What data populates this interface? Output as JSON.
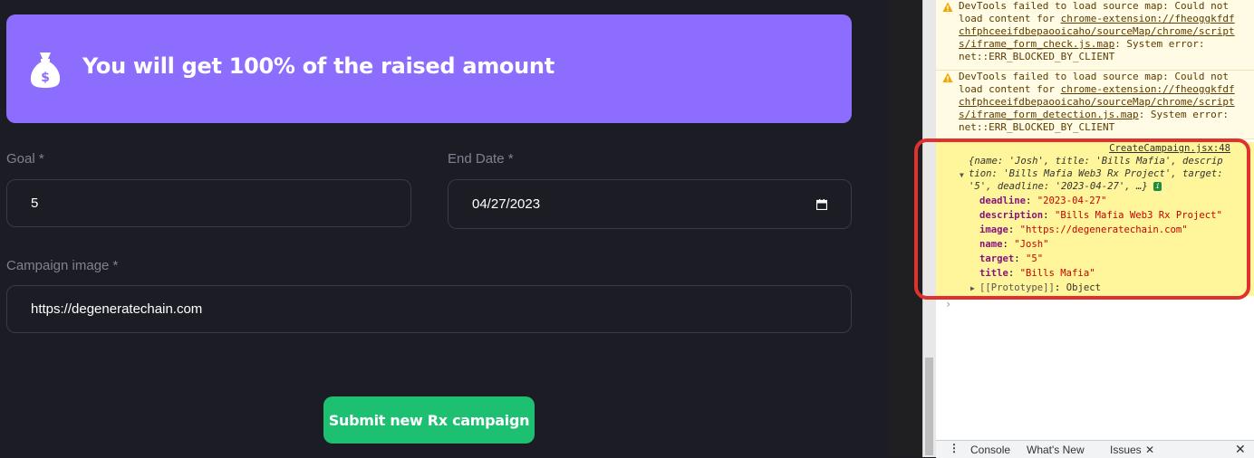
{
  "banner": {
    "text": "You will get 100% of the raised amount",
    "icon": "money-bag-icon"
  },
  "form": {
    "goal_label": "Goal *",
    "goal_value": "5",
    "end_date_label": "End Date *",
    "end_date_value": "04/27/2023",
    "image_label": "Campaign image *",
    "image_value": "https://degeneratechain.com",
    "submit_label": "Submit new Rx campaign"
  },
  "devtools": {
    "warnings": [
      {
        "lines": [
          "DevTools failed to load source map: Could not",
          "load content for ",
          "chrome-extension://fheoggkfdf",
          "chfphceeifdbepaooicaho/sourceMap/chrome/script",
          "s/iframe_form_check.js.map",
          ": System error:",
          "net::ERR_BLOCKED_BY_CLIENT"
        ]
      },
      {
        "lines": [
          "DevTools failed to load source map: Could not",
          "load content for ",
          "chrome-extension://fheoggkfdf",
          "chfphceeifdbepaooicaho/sourceMap/chrome/script",
          "s/iframe_form_detection.js.map",
          ": System error:",
          "net::ERR_BLOCKED_BY_CLIENT"
        ]
      }
    ],
    "log": {
      "source": "CreateCampaign.jsx:48",
      "summary_1": "{name: 'Josh', title: 'Bills Mafia', descrip",
      "summary_2": "tion: 'Bills Mafia Web3 Rx Project', target:",
      "summary_3": "'5', deadline: '2023-04-27', …}",
      "props": [
        {
          "key": "deadline",
          "value": "\"2023-04-27\""
        },
        {
          "key": "description",
          "value": "\"Bills Mafia Web3 Rx Project\""
        },
        {
          "key": "image",
          "value": "\"https://degeneratechain.com\""
        },
        {
          "key": "name",
          "value": "\"Josh\""
        },
        {
          "key": "target",
          "value": "\"5\""
        },
        {
          "key": "title",
          "value": "\"Bills Mafia\""
        }
      ],
      "prototype_key": "[[Prototype]]",
      "prototype_value": "Object"
    },
    "drawer_tabs": [
      "Console",
      "What's New",
      "Issues"
    ],
    "colors": {
      "highlight": "#e0312f",
      "log_bg": "#fff59a",
      "accent": "#8c6dfd",
      "button": "#1dc071"
    }
  }
}
